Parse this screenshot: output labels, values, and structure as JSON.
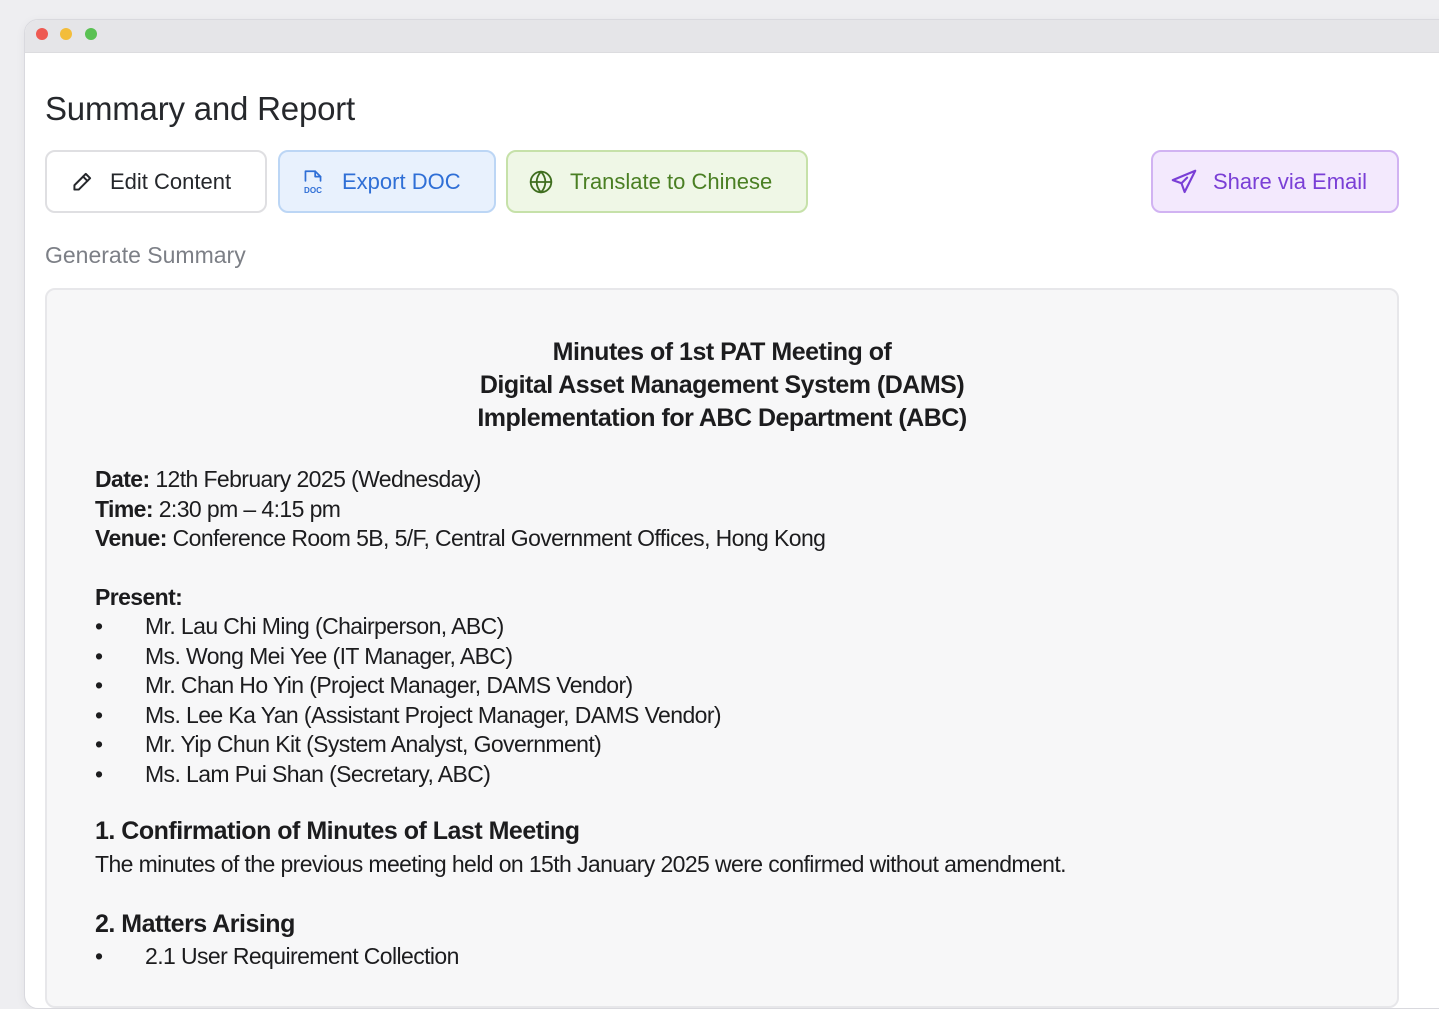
{
  "page": {
    "title": "Summary and Report",
    "section_label": "Generate Summary"
  },
  "toolbar": {
    "edit_label": "Edit Content",
    "export_label": "Export DOC",
    "export_icon_text": "DOC",
    "translate_label": "Translate to Chinese",
    "share_label": "Share via Email"
  },
  "colors": {
    "export_accent": "#2f6fd6",
    "translate_accent": "#4a7f23",
    "share_accent": "#7a3fd6"
  },
  "icons": {
    "edit": "pencil-icon",
    "export": "doc-file-icon",
    "translate": "globe-icon",
    "share": "send-icon"
  },
  "document": {
    "title_lines": [
      "Minutes of 1st PAT Meeting of",
      "Digital Asset Management System (DAMS)",
      "Implementation for ABC Department (ABC)"
    ],
    "meta": {
      "date_label": "Date:",
      "date_value": "12th February 2025 (Wednesday)",
      "time_label": "Time:",
      "time_value": "2:30 pm – 4:15 pm",
      "venue_label": "Venue:",
      "venue_value": "Conference Room 5B, 5/F, Central Government Offices, Hong Kong"
    },
    "present_title": "Present:",
    "present": [
      "Mr. Lau Chi Ming (Chairperson, ABC)",
      "Ms. Wong Mei Yee (IT Manager, ABC)",
      "Mr. Chan Ho Yin (Project Manager, DAMS Vendor)",
      "Ms. Lee Ka Yan (Assistant Project Manager, DAMS Vendor)",
      "Mr. Yip Chun Kit (System Analyst, Government)",
      "Ms. Lam Pui Shan (Secretary, ABC)"
    ],
    "section1": {
      "heading": "1. Confirmation of Minutes of Last Meeting",
      "body": "The minutes of the previous meeting held on 15th January 2025 were confirmed without amendment."
    },
    "section2": {
      "heading": "2. Matters Arising",
      "items": [
        "2.1 User Requirement Collection"
      ]
    }
  }
}
